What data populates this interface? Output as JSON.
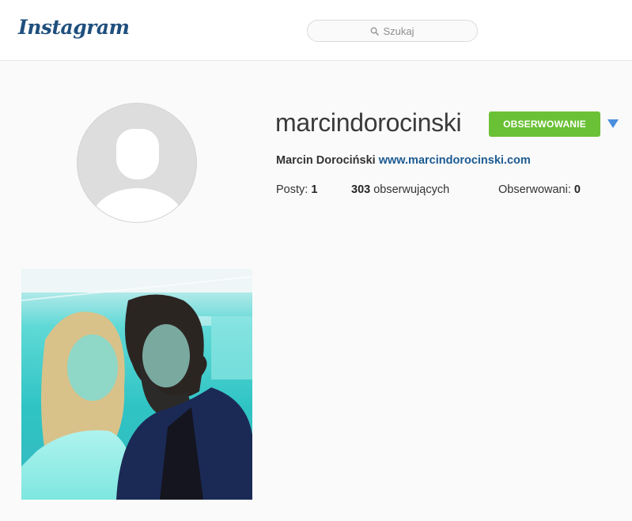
{
  "header": {
    "logo_text": "Instagram",
    "search_placeholder": "Szukaj",
    "search_icon": "search-icon"
  },
  "profile": {
    "username": "marcindorocinski",
    "follow_button_label": "OBSERWOWANIE",
    "dropdown_icon": "triangle-down-icon",
    "full_name": "Marcin Dorociński",
    "website": "www.marcindorocinski.com",
    "avatar": "default-avatar-placeholder"
  },
  "stats": {
    "posts_label": "Posty:",
    "posts_count": "1",
    "followers_count": "303",
    "followers_label": "obserwujących",
    "following_label": "Obserwowani:",
    "following_count": "0"
  },
  "posts": [
    {
      "description": "photo",
      "type": "image"
    }
  ],
  "colors": {
    "follow_button": "#6bc136",
    "link": "#1c5a92",
    "logo": "#1f4f7e",
    "dropdown_arrow": "#4a8fde"
  }
}
